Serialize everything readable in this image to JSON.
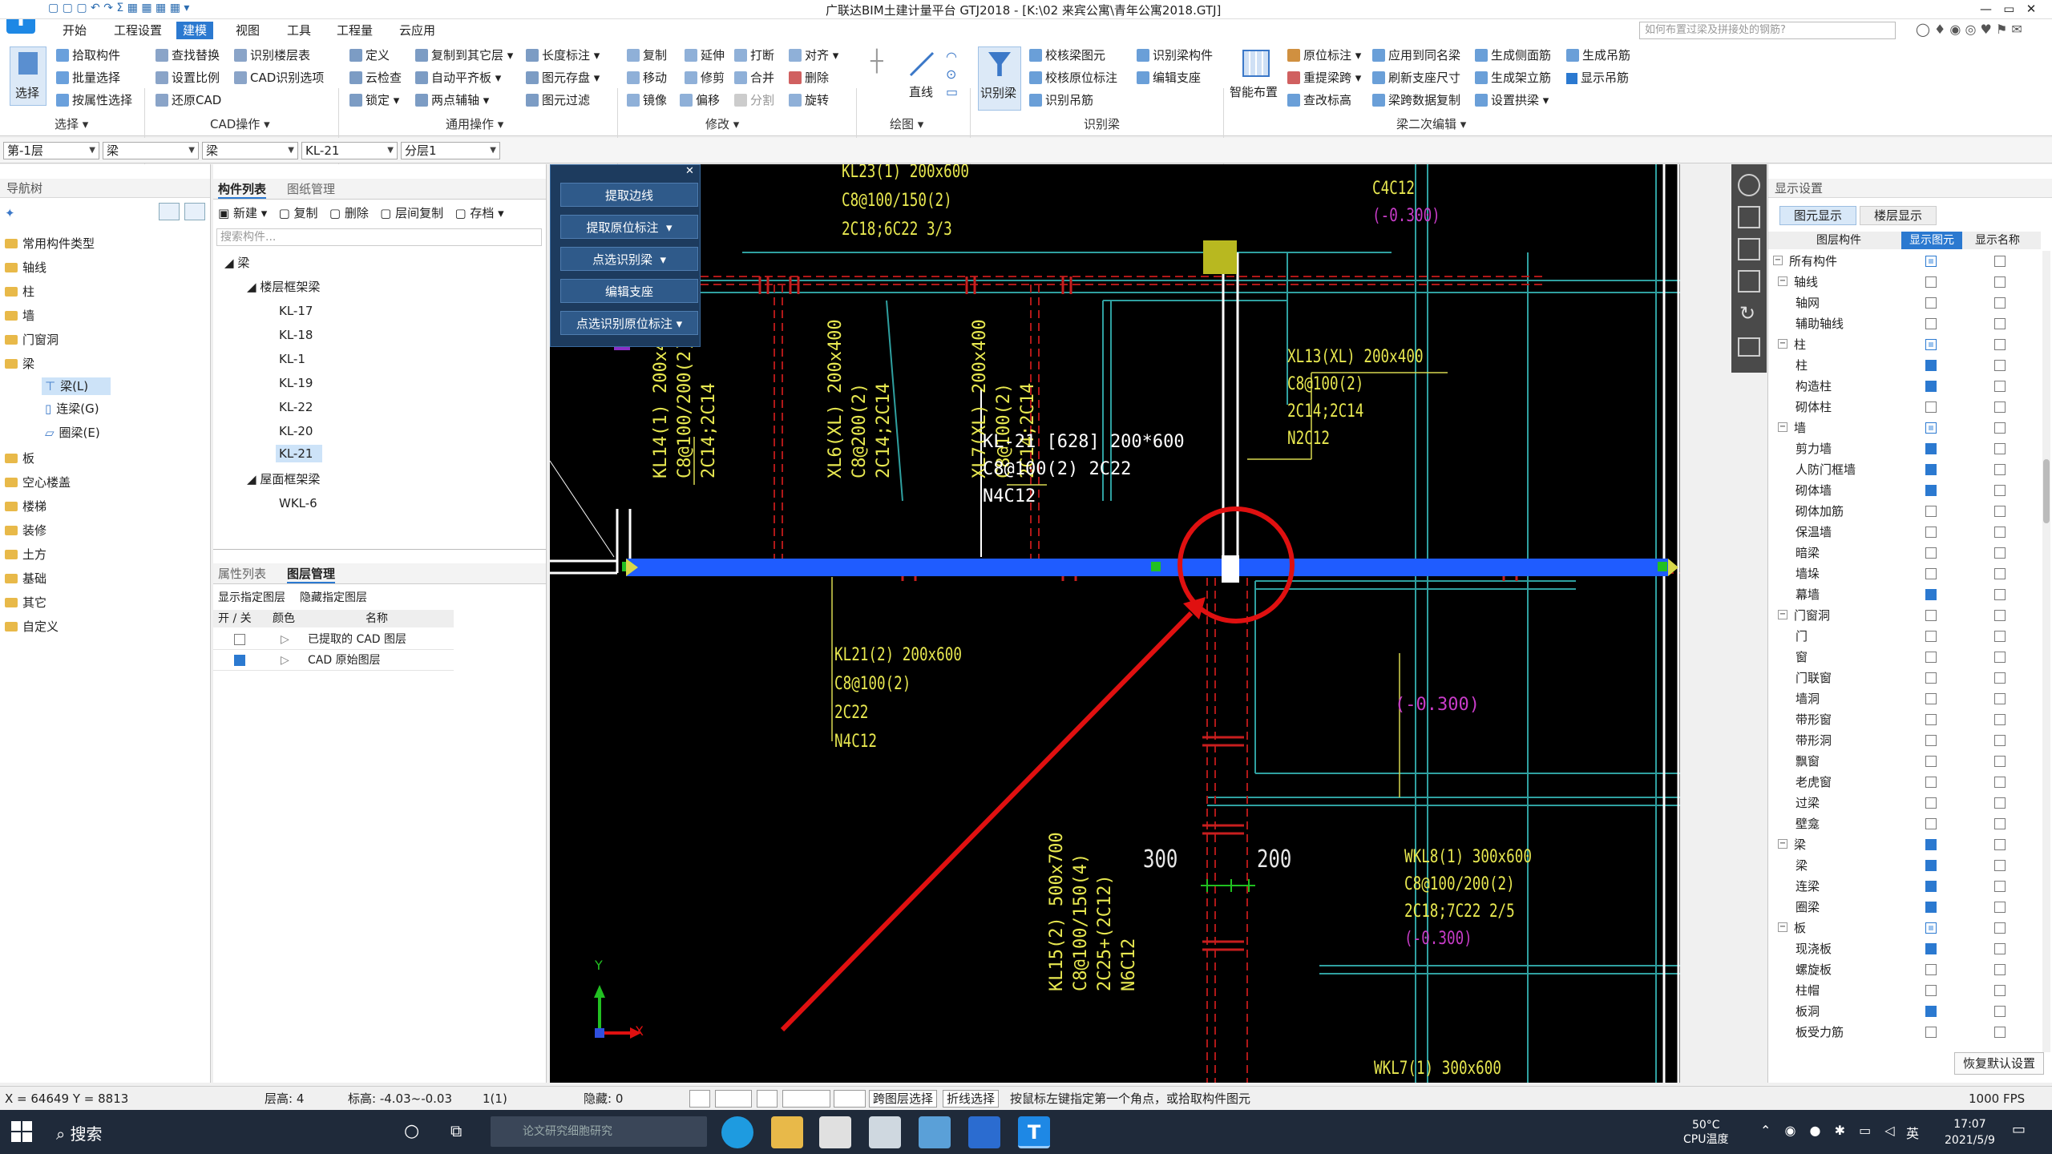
{
  "window": {
    "title": "广联达BIM土建计量平台 GTJ2018 - [K:\\02 来宾公寓\\青年公寓2018.GTJ]",
    "search_placeholder": "如何布置过梁及拼接处的钢筋?"
  },
  "menu": [
    "开始",
    "工程设置",
    "建模",
    "视图",
    "工具",
    "工程量",
    "云应用"
  ],
  "menu_active": "建模",
  "ribbon": {
    "select_label": "选择",
    "groups": [
      {
        "label": "选择",
        "items": [
          "拾取构件",
          "批量选择",
          "按属性选择"
        ]
      },
      {
        "label": "CAD操作",
        "items": [
          "查找替换",
          "识别楼层表",
          "设置比例",
          "CAD识别选项",
          "还原CAD"
        ]
      },
      {
        "label": "通用操作",
        "items": [
          "定义",
          "复制到其它层",
          "长度标注",
          "云检查",
          "自动平齐板",
          "图元存盘",
          "锁定",
          "两点辅轴",
          "图元过滤"
        ]
      },
      {
        "label": "修改",
        "items": [
          "复制",
          "延伸",
          "打断",
          "对齐",
          "移动",
          "修剪",
          "合并",
          "删除",
          "镜像",
          "偏移",
          "分割",
          "旋转"
        ]
      },
      {
        "label": "绘图",
        "items": [
          "直线"
        ]
      },
      {
        "label": "识别梁",
        "items": [
          "识别梁",
          "校核梁图元",
          "识别梁构件",
          "校核原位标注",
          "编辑支座",
          "识别吊筋"
        ]
      },
      {
        "label": "梁二次编辑",
        "items": [
          "智能布置",
          "原位标注",
          "应用到同名梁",
          "生成侧面筋",
          "生成吊筋",
          "重提梁跨",
          "刷新支座尺寸",
          "生成架立筋",
          "显示吊筋",
          "查改标高",
          "梁跨数据复制",
          "设置拱梁"
        ]
      }
    ]
  },
  "combos": [
    "第-1层",
    "梁",
    "梁",
    "KL-21",
    "分层1"
  ],
  "nav": {
    "title": "导航树",
    "items": [
      "常用构件类型",
      "轴线",
      "柱",
      "墙",
      "门窗洞",
      "梁",
      "梁(L)",
      "连梁(G)",
      "圈梁(E)",
      "板",
      "空心楼盖",
      "楼梯",
      "装修",
      "土方",
      "基础",
      "其它",
      "自定义"
    ],
    "selected": "梁(L)"
  },
  "component_list": {
    "tabs": [
      "构件列表",
      "图纸管理"
    ],
    "toolbar": [
      "新建",
      "复制",
      "删除",
      "层间复制",
      "存档"
    ],
    "search_placeholder": "搜索构件...",
    "root": "梁",
    "group1": "楼层框架梁",
    "items1": [
      "KL-17",
      "KL-18",
      "KL-1",
      "KL-19",
      "KL-22",
      "KL-20",
      "KL-21"
    ],
    "selected": "KL-21",
    "group2": "屋面框架梁",
    "items2": [
      "WKL-6"
    ]
  },
  "layer_panel": {
    "tabs": [
      "属性列表",
      "图层管理"
    ],
    "links": [
      "显示指定图层",
      "隐藏指定图层"
    ],
    "headers": [
      "开 / 关",
      "颜色",
      "名称"
    ],
    "rows": [
      {
        "name": "已提取的 CAD 图层",
        "on": false
      },
      {
        "name": "CAD 原始图层",
        "on": true
      }
    ]
  },
  "popup": {
    "items": [
      "提取边线",
      "提取原位标注",
      "点选识别梁",
      "编辑支座",
      "点选识别原位标注"
    ]
  },
  "cad_text": {
    "kl21_tip": [
      "KL-21 [628] 200*600",
      "C8@100(2) 2C22",
      "N4C12"
    ],
    "top_a": [
      "KL23(1) 200x600",
      "C8@100/150(2)",
      "2C18;6C22 3/3"
    ],
    "top_b": [
      "C4C12",
      "(-0.300)"
    ],
    "xl13": [
      "XL13(XL) 200x400",
      "C8@100(2)",
      "2C14;2C14",
      "N2C12"
    ],
    "kl14": [
      "KL14(1) 200x400",
      "C8@100/200(2)",
      "2C14;2C14"
    ],
    "xl6": [
      "XL6(XL) 200x400",
      "C8@200(2)",
      "2C14;2C14"
    ],
    "xl7": [
      "XL7(XL) 200x400",
      "C8@100(2)",
      "2C14;2C14"
    ],
    "kl21": [
      "KL21(2) 200x600",
      "C8@100(2)",
      "2C22",
      "N4C12"
    ],
    "level_mid": "(-0.300)",
    "dim_300": "300",
    "dim_200": "200",
    "wkl8": [
      "WKL8(1) 300x600",
      "C8@100/200(2)",
      "2C18;7C22 2/5",
      "(-0.300)"
    ],
    "kl15": [
      "KL15(2) 500x700",
      "C8@100/150(4)",
      "2C25+(2C12)",
      "N6C12"
    ],
    "wkl7": "WKL7(1) 300x600",
    "axis_y": "Y",
    "axis_x": "X"
  },
  "display_settings": {
    "title": "显示设置",
    "tabs": [
      "图元显示",
      "楼层显示"
    ],
    "headers": [
      "图层构件",
      "显示图元",
      "显示名称"
    ],
    "rows": [
      {
        "label": "所有构件",
        "level": 0,
        "show": "part",
        "name": false
      },
      {
        "label": "轴线",
        "level": 1,
        "show": "off",
        "name": false
      },
      {
        "label": "轴网",
        "level": 2,
        "show": "off",
        "name": false
      },
      {
        "label": "辅助轴线",
        "level": 2,
        "show": "off",
        "name": false
      },
      {
        "label": "柱",
        "level": 1,
        "show": "part",
        "name": false
      },
      {
        "label": "柱",
        "level": 2,
        "show": "on",
        "name": false
      },
      {
        "label": "构造柱",
        "level": 2,
        "show": "on",
        "name": false
      },
      {
        "label": "砌体柱",
        "level": 2,
        "show": "off",
        "name": false
      },
      {
        "label": "墙",
        "level": 1,
        "show": "part",
        "name": false
      },
      {
        "label": "剪力墙",
        "level": 2,
        "show": "on",
        "name": false
      },
      {
        "label": "人防门框墙",
        "level": 2,
        "show": "on",
        "name": false
      },
      {
        "label": "砌体墙",
        "level": 2,
        "show": "on",
        "name": false
      },
      {
        "label": "砌体加筋",
        "level": 2,
        "show": "off",
        "name": false
      },
      {
        "label": "保温墙",
        "level": 2,
        "show": "off",
        "name": false
      },
      {
        "label": "暗梁",
        "level": 2,
        "show": "off",
        "name": false
      },
      {
        "label": "墙垛",
        "level": 2,
        "show": "off",
        "name": false
      },
      {
        "label": "幕墙",
        "level": 2,
        "show": "on",
        "name": false
      },
      {
        "label": "门窗洞",
        "level": 1,
        "show": "off",
        "name": false
      },
      {
        "label": "门",
        "level": 2,
        "show": "off",
        "name": false
      },
      {
        "label": "窗",
        "level": 2,
        "show": "off",
        "name": false
      },
      {
        "label": "门联窗",
        "level": 2,
        "show": "off",
        "name": false
      },
      {
        "label": "墙洞",
        "level": 2,
        "show": "off",
        "name": false
      },
      {
        "label": "带形窗",
        "level": 2,
        "show": "off",
        "name": false
      },
      {
        "label": "带形洞",
        "level": 2,
        "show": "off",
        "name": false
      },
      {
        "label": "飘窗",
        "level": 2,
        "show": "off",
        "name": false
      },
      {
        "label": "老虎窗",
        "level": 2,
        "show": "off",
        "name": false
      },
      {
        "label": "过梁",
        "level": 2,
        "show": "off",
        "name": false
      },
      {
        "label": "壁龛",
        "level": 2,
        "show": "off",
        "name": false
      },
      {
        "label": "梁",
        "level": 1,
        "show": "on",
        "name": false
      },
      {
        "label": "梁",
        "level": 2,
        "show": "on",
        "name": false
      },
      {
        "label": "连梁",
        "level": 2,
        "show": "on",
        "name": false
      },
      {
        "label": "圈梁",
        "level": 2,
        "show": "on",
        "name": false
      },
      {
        "label": "板",
        "level": 1,
        "show": "part",
        "name": false
      },
      {
        "label": "现浇板",
        "level": 2,
        "show": "on",
        "name": false
      },
      {
        "label": "螺旋板",
        "level": 2,
        "show": "off",
        "name": false
      },
      {
        "label": "柱帽",
        "level": 2,
        "show": "off",
        "name": false
      },
      {
        "label": "板洞",
        "level": 2,
        "show": "on",
        "name": false
      },
      {
        "label": "板受力筋",
        "level": 2,
        "show": "off",
        "name": false
      }
    ],
    "restore_button": "恢复默认设置"
  },
  "status": {
    "coords": "X = 64649 Y = 8813",
    "floor_height": "层高:  4",
    "elevation": "标高:  -4.03~-0.03",
    "count": "1(1)",
    "hidden": "隐藏:  0",
    "cross_layer": "跨图层选择",
    "polyline": "折线选择",
    "hint": "按鼠标左键指定第一个角点，或拾取构件图元",
    "fps": "1000 FPS"
  },
  "taskbar": {
    "search": "搜索",
    "search_box": "论文研究细胞研究",
    "temp": "50°C",
    "temp_label": "CPU温度",
    "ime": "英",
    "time": "17:07",
    "date": "2021/5/9"
  },
  "colors": {
    "accent": "#2b79d0",
    "beam_blue": "#1f5cff",
    "cad_yellow": "#e8e850",
    "cad_magenta": "#c83cc8",
    "cad_red": "#c81e1e",
    "cad_cyan": "#3ab0b0",
    "annotation_red": "#e01010"
  }
}
